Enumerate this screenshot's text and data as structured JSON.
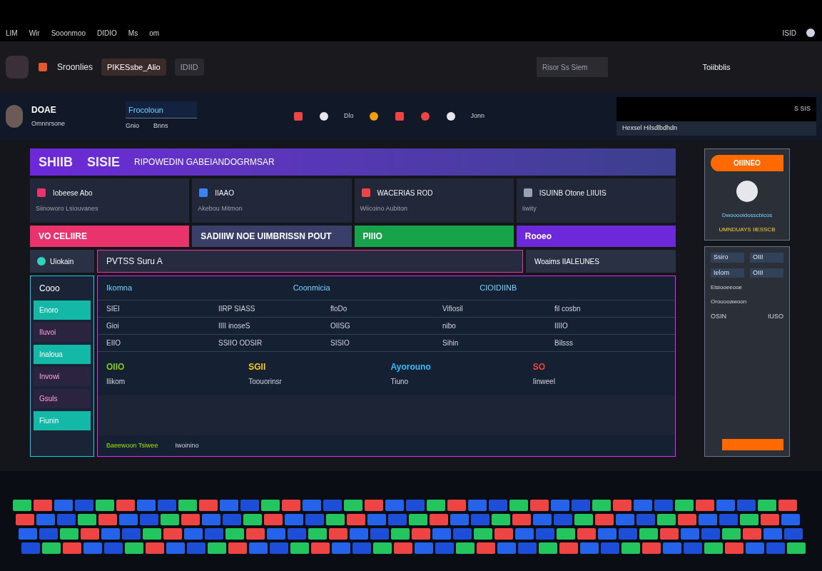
{
  "top_bar": {
    "items": [
      "LIM",
      "Wir",
      "Sooonmoo",
      "DIDIO",
      "Ms",
      "om"
    ],
    "status": "ISID"
  },
  "header": {
    "app_name": "Sroonlies",
    "tabs": [
      {
        "label": "PIKESsbe_Alio",
        "selected": true
      },
      {
        "label": "IDIID",
        "selected": false
      }
    ],
    "search_placeholder": "Risor Ss Siem",
    "panel_title": "Toiibblis"
  },
  "profile": {
    "name": "DOAE",
    "subtitle": "Omnnrsone",
    "search_value": "Frocoloun",
    "links": [
      "Gnio",
      "Bnns"
    ],
    "tool_labels": [
      "Dlo",
      "Jonn"
    ],
    "panel_actions": "S SIS",
    "panel_row": "Hexsel Hilsdlbdhdn"
  },
  "banner": {
    "title": "SHIIB",
    "title_2": "SISIE",
    "subtitle": "RIPOWEDIN GABEIANDOGRMSAR"
  },
  "tiles": [
    {
      "label": "Iobeese Abo",
      "sub": "Siinoworo Lsiouvanes",
      "color": "#e8336d"
    },
    {
      "label": "IIAAO",
      "sub": "Akebou Mitmon",
      "color": "#3b82f6"
    },
    {
      "label": "WACERIAS ROD",
      "sub": "Wiicoino Aubiton",
      "color": "#ef4444"
    },
    {
      "label": "ISUINB Otone LIIUIS",
      "sub": "Iiwity",
      "color": "#94a3b8"
    }
  ],
  "promos": [
    {
      "label": "VO CELIIRE",
      "color": "#e8336d"
    },
    {
      "label": "SADIIIW NOE UIMBRISSN POUT",
      "color": "#3a3f6a"
    },
    {
      "label": "PIIIO",
      "color": "#16a34a"
    },
    {
      "label": "Rooeo",
      "color": "#6d28d9"
    }
  ],
  "strip": {
    "label": "Uiokain",
    "title": "PVTSS Suru A",
    "side": "Woaims IIALEUNES"
  },
  "nav": {
    "title": "Cooo",
    "items": [
      {
        "label": "Enoro",
        "selected": true
      },
      {
        "label": "Iluvoi",
        "selected": false
      },
      {
        "label": "Inaloua",
        "selected": true
      },
      {
        "label": "Invowi",
        "selected": false
      },
      {
        "label": "Gsuls",
        "selected": false
      },
      {
        "label": "Fiunin",
        "selected": true
      }
    ]
  },
  "table": {
    "headers": [
      "Ikomna",
      "Coonmicia",
      "CIOIDIINB"
    ],
    "rows": [
      [
        "SIEI",
        "IIRP SIASS",
        "floDo",
        "Vifiosil",
        "fil cosbn"
      ],
      [
        "Gioi",
        "IIII inoseS",
        "OIISG",
        "nibo",
        "IIIIO"
      ],
      [
        "EIIO",
        "SSIIO ODSIR",
        "SISIO",
        "Sihin",
        "Bilsss"
      ]
    ]
  },
  "stats": [
    {
      "value": "OIIO",
      "label": "Ilikom",
      "color": "#84cc16"
    },
    {
      "value": "SGII",
      "label": "Toouorinsr",
      "color": "#facc15"
    },
    {
      "value": "Ayorouno",
      "label": "Tiuno",
      "color": "#38bdf8"
    },
    {
      "value": "SO",
      "label": "Iinweel",
      "color": "#ef4444"
    }
  ],
  "footer": [
    "Baeewoon Tsiwee",
    "Iwoinino"
  ],
  "side_panel": {
    "button": "OIIINEO",
    "caption": "Dwooooidosscbicos",
    "caption_2": "UMNDUAYS IIESSCB",
    "grid": [
      "Ssiro",
      "OIII",
      "Ielom",
      "OIII"
    ],
    "notes": [
      "Eisiooeeooe",
      "Orouooawoon"
    ],
    "row": [
      "OSIN",
      "IUSO"
    ]
  }
}
